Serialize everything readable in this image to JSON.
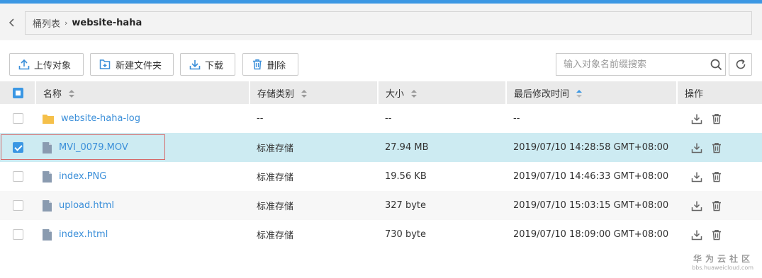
{
  "breadcrumb": {
    "root": "桶列表",
    "current": "website-haha"
  },
  "toolbar": {
    "upload": "上传对象",
    "new_folder": "新建文件夹",
    "download": "下载",
    "delete": "删除",
    "search_placeholder": "输入对象名前缀搜索"
  },
  "table": {
    "headers": {
      "name": "名称",
      "storage": "存储类别",
      "size": "大小",
      "modified": "最后修改时间",
      "ops": "操作"
    },
    "rows": [
      {
        "name": "website-haha-log",
        "type": "folder",
        "storage": "--",
        "size": "--",
        "modified": "--",
        "checked": false
      },
      {
        "name": "MVI_0079.MOV",
        "type": "file",
        "storage": "标准存储",
        "size": "27.94 MB",
        "modified": "2019/07/10 14:28:58 GMT+08:00",
        "checked": true
      },
      {
        "name": "index.PNG",
        "type": "file",
        "storage": "标准存储",
        "size": "19.56 KB",
        "modified": "2019/07/10 14:46:33 GMT+08:00",
        "checked": false
      },
      {
        "name": "upload.html",
        "type": "file",
        "storage": "标准存储",
        "size": "327 byte",
        "modified": "2019/07/10 15:03:15 GMT+08:00",
        "checked": false
      },
      {
        "name": "index.html",
        "type": "file",
        "storage": "标准存储",
        "size": "730 byte",
        "modified": "2019/07/10 18:09:00 GMT+08:00",
        "checked": false
      }
    ]
  },
  "watermark": {
    "title": "华为云社区",
    "url": "bbs.huaweicloud.com"
  },
  "colors": {
    "accent": "#3b97e3",
    "link": "#3b8fd9",
    "selected_row": "#cdebf2",
    "folder": "#f5c04a",
    "file_icon": "#8a9bb0"
  }
}
